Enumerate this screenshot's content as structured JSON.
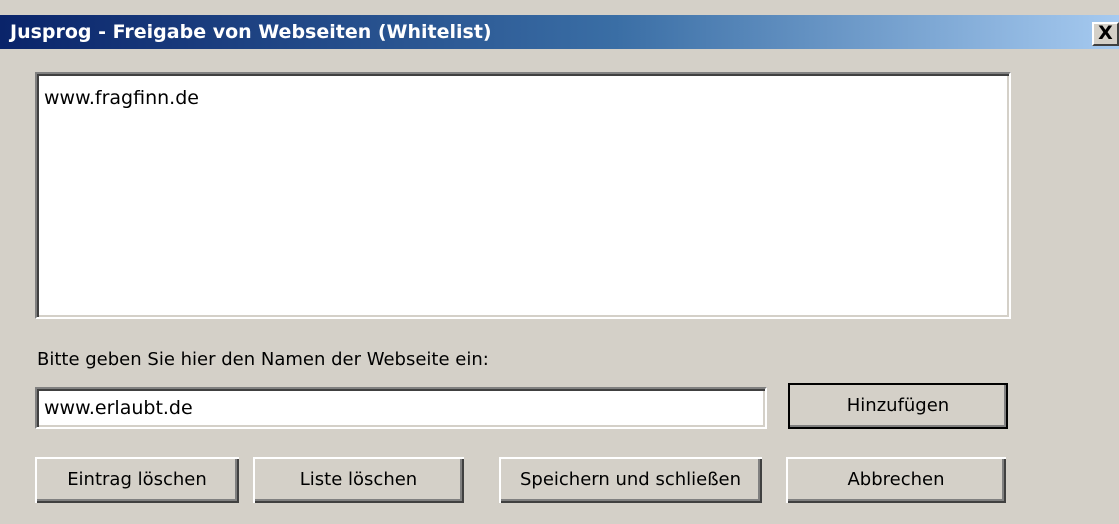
{
  "window": {
    "title": "Jusprog - Freigabe von Webseiten (Whitelist)",
    "close_label": "X"
  },
  "whitelist": {
    "items": [
      "www.fragfinn.de"
    ]
  },
  "input": {
    "label": "Bitte geben Sie hier den Namen der Webseite ein:",
    "value": "www.erlaubt.de"
  },
  "buttons": {
    "add": "Hinzufügen",
    "delete_entry": "Eintrag löschen",
    "delete_list": "Liste löschen",
    "save_close": "Speichern und schließen",
    "cancel": "Abbrechen"
  }
}
